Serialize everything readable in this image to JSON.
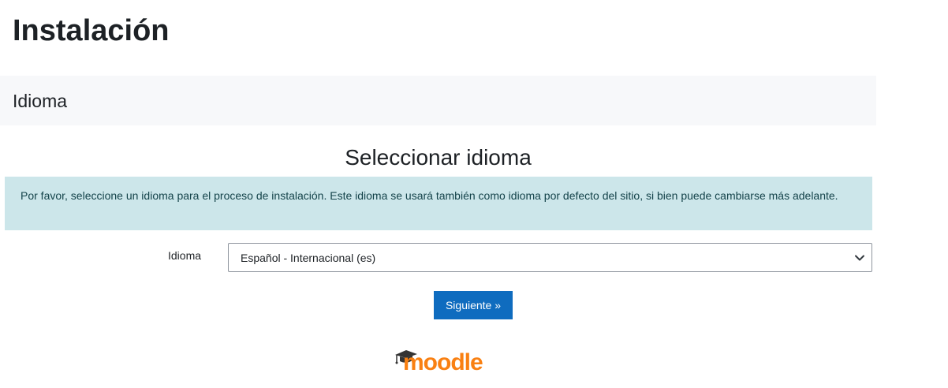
{
  "header": {
    "title": "Instalación"
  },
  "section": {
    "title": "Idioma"
  },
  "stage": {
    "heading": "Seleccionar idioma"
  },
  "alert": {
    "text": "Por favor, seleccione un idioma para el proceso de instalación. Este idioma se usará también como idioma por defecto del sitio, si bien puede cambiarse más adelante."
  },
  "form": {
    "language_label": "Idioma",
    "language_selected": "Español - Internacional (es)"
  },
  "buttons": {
    "next_label": "Siguiente »"
  },
  "logo": {
    "text": "moodle",
    "brand_color": "#f98012",
    "cap_color": "#333333"
  },
  "colors": {
    "primary": "#0f6cbf",
    "alert_bg": "#cce6ea",
    "section_bg": "#f7f8fa"
  }
}
